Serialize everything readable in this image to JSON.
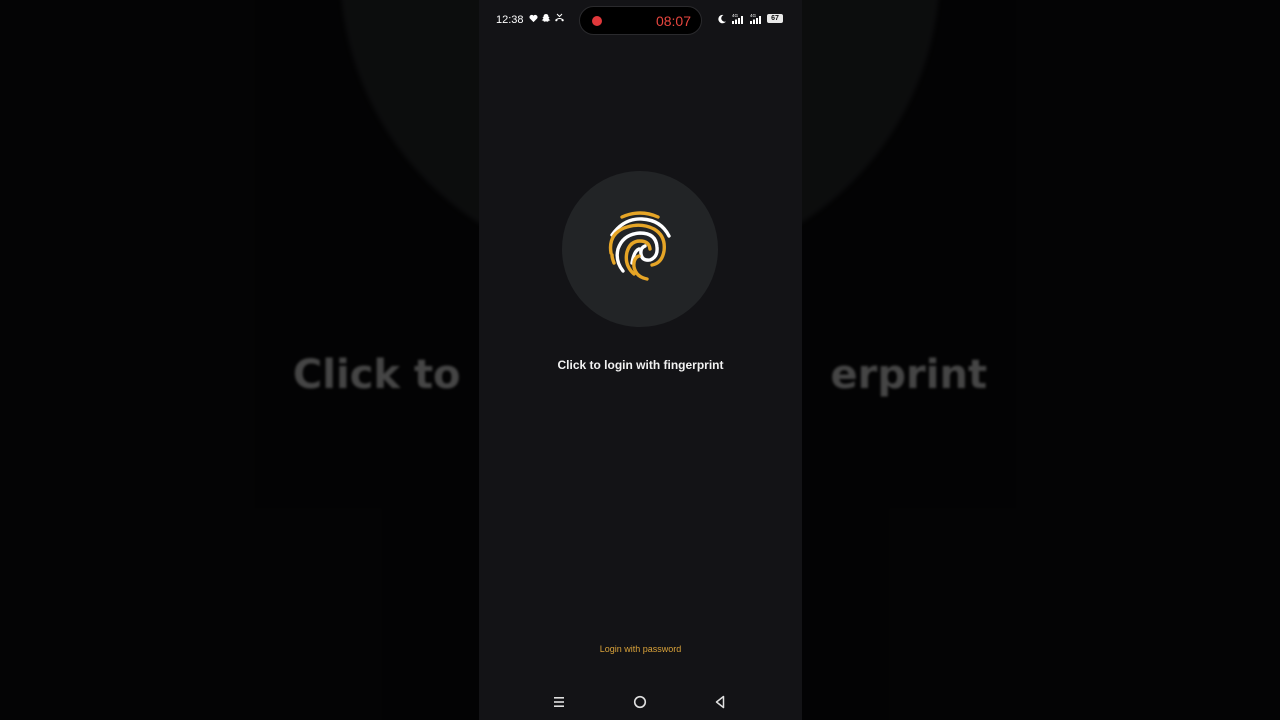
{
  "background": {
    "caption_left": "Click to",
    "caption_right": "erprint"
  },
  "status_bar": {
    "time": "12:38",
    "notification_icons": [
      "heart-icon",
      "snapchat-icon",
      "missed-call-icon"
    ],
    "recorder_time": "08:07",
    "right_icons": [
      "moon-icon",
      "signal-4g-icon",
      "signal-4g-icon"
    ],
    "network_label": "4G",
    "battery": "67"
  },
  "login": {
    "fingerprint_caption": "Click to login with fingerprint",
    "password_link": "Login with password"
  },
  "colors": {
    "accent": "#e6a526",
    "fingerprint_white": "#ffffff",
    "circle_bg": "#222426",
    "screen_bg": "#131316",
    "link": "#d9a23a",
    "recording": "#e0383b"
  },
  "nav_bar": {
    "icons": [
      "menu-icon",
      "home-icon",
      "back-icon"
    ]
  }
}
